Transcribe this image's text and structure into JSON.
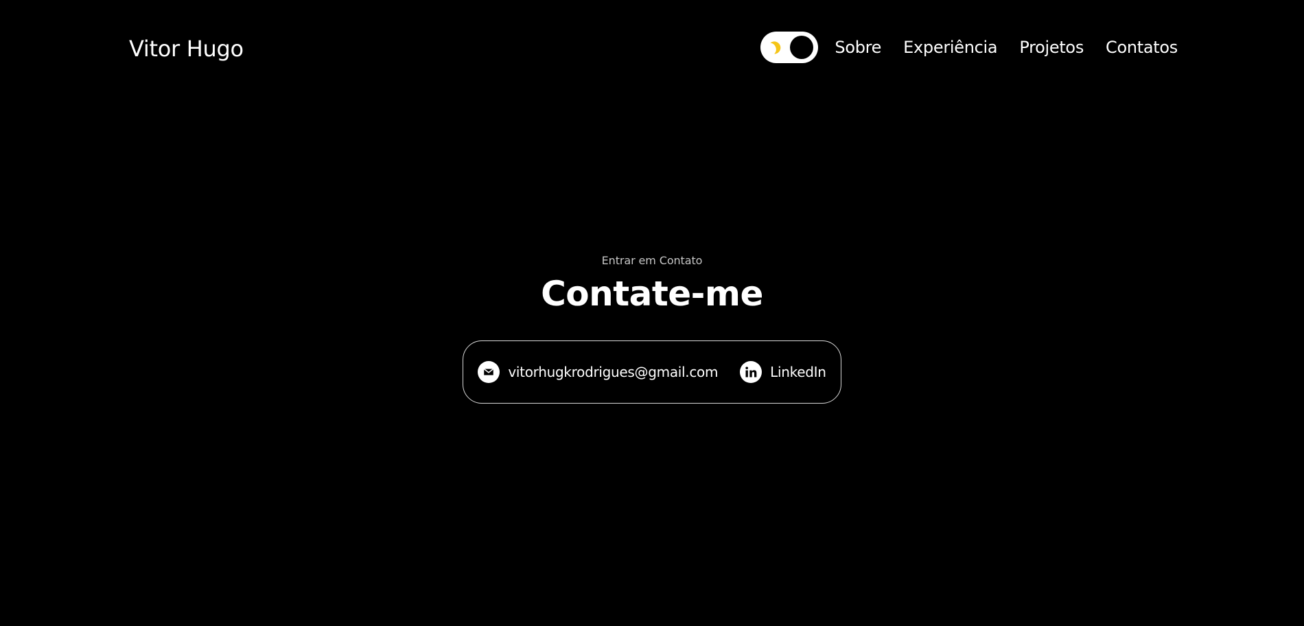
{
  "header": {
    "logo": "Vitor Hugo",
    "theme_toggle": {
      "mode": "dark",
      "icon": "moon-icon",
      "accent_color": "#f5c518"
    },
    "nav": [
      {
        "label": "Sobre"
      },
      {
        "label": "Experiência"
      },
      {
        "label": "Projetos"
      },
      {
        "label": "Contatos"
      }
    ]
  },
  "contact": {
    "eyebrow": "Entrar em Contato",
    "title": "Contate-me",
    "items": [
      {
        "icon": "mail-icon",
        "label": "vitorhugkrodrigues@gmail.com"
      },
      {
        "icon": "linkedin-icon",
        "label": "LinkedIn"
      }
    ]
  },
  "colors": {
    "background": "#000000",
    "text": "#ffffff",
    "muted": "#c7c7c7",
    "accent": "#f5c518"
  }
}
